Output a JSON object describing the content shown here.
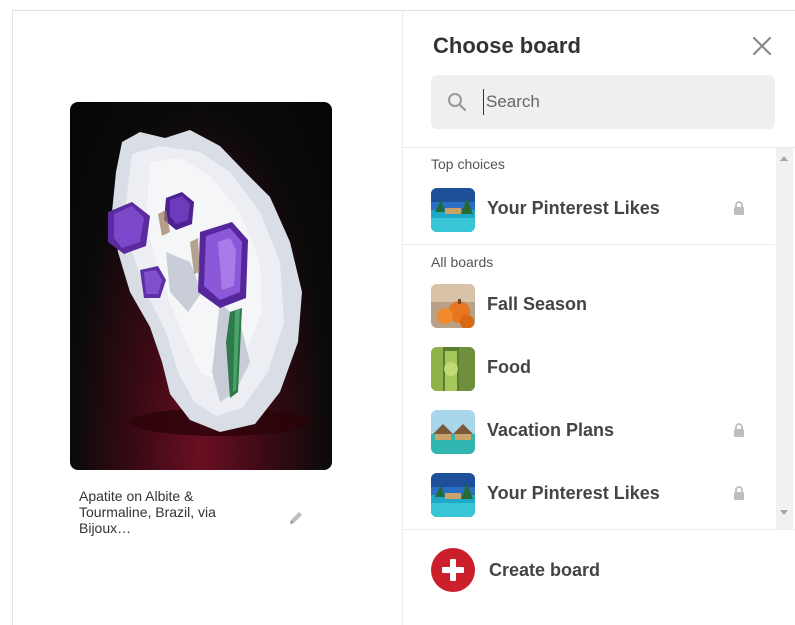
{
  "pin": {
    "caption": "Apatite on Albite & Tourmaline, Brazil, via Bijoux…",
    "image_icon": "mineral-photo",
    "edit_icon": "pencil-icon"
  },
  "dialog": {
    "title": "Choose board",
    "close_icon": "close-icon",
    "search": {
      "placeholder": "Search",
      "value": "",
      "icon": "search-icon"
    },
    "sections": [
      {
        "label": "Top choices",
        "boards": [
          {
            "name": "Your Pinterest Likes",
            "private": true,
            "thumb": "beach-resort"
          }
        ]
      },
      {
        "label": "All boards",
        "boards": [
          {
            "name": "Fall Season",
            "private": false,
            "thumb": "pumpkins"
          },
          {
            "name": "Food",
            "private": false,
            "thumb": "greens"
          },
          {
            "name": "Vacation Plans",
            "private": true,
            "thumb": "overwater-villas"
          },
          {
            "name": "Your Pinterest Likes",
            "private": true,
            "thumb": "beach-resort"
          }
        ]
      }
    ],
    "create_board_label": "Create board",
    "colors": {
      "accent_red": "#cc1f2c",
      "search_bg": "#efefef",
      "text": "#444444"
    }
  }
}
